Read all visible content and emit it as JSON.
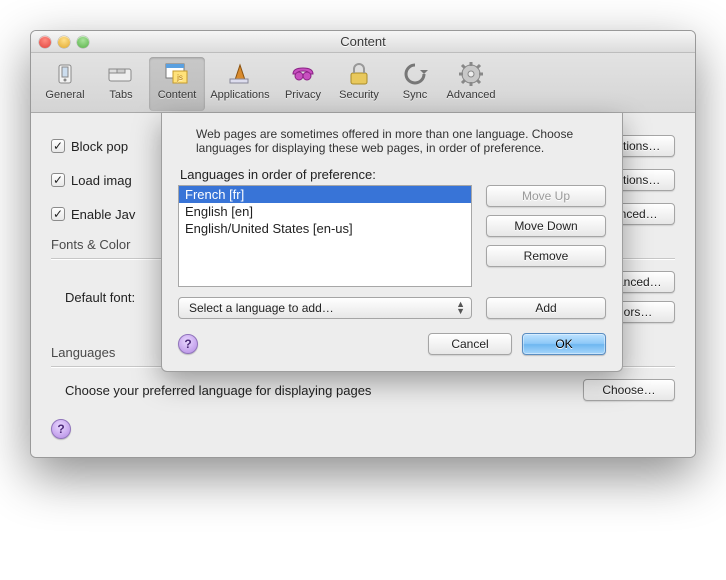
{
  "window": {
    "title": "Content"
  },
  "toolbar": {
    "items": [
      {
        "label": "General",
        "icon": "switch-icon",
        "selected": false
      },
      {
        "label": "Tabs",
        "icon": "tabs-icon",
        "selected": false
      },
      {
        "label": "Content",
        "icon": "content-icon",
        "selected": true
      },
      {
        "label": "Applications",
        "icon": "apps-icon",
        "selected": false
      },
      {
        "label": "Privacy",
        "icon": "privacy-icon",
        "selected": false
      },
      {
        "label": "Security",
        "icon": "security-icon",
        "selected": false
      },
      {
        "label": "Sync",
        "icon": "sync-icon",
        "selected": false
      },
      {
        "label": "Advanced",
        "icon": "advanced-icon",
        "selected": false
      }
    ]
  },
  "main": {
    "block_popups": {
      "label": "Block pop",
      "checked": true
    },
    "load_images": {
      "label": "Load imag",
      "checked": true
    },
    "enable_js": {
      "label": "Enable Jav",
      "checked": true
    },
    "exceptions_btn": "xceptions…",
    "exceptions_btn2": "xceptions…",
    "advanced_btn": "dvanced…",
    "fonts_header": "Fonts & Color",
    "default_font_label": "Default font:",
    "advanced_btn2": "Advanced…",
    "colors_btn": "Colors…",
    "languages_header": "Languages",
    "languages_prompt": "Choose your preferred language for displaying pages",
    "choose_btn": "Choose…"
  },
  "sheet": {
    "desc": "Web pages are sometimes offered in more than one language. Choose languages for displaying these web pages, in order of preference.",
    "list_label": "Languages in order of preference:",
    "items": [
      {
        "label": "French  [fr]",
        "selected": true
      },
      {
        "label": "English  [en]",
        "selected": false
      },
      {
        "label": "English/United States  [en-us]",
        "selected": false
      }
    ],
    "move_up": "Move Up",
    "move_down": "Move Down",
    "remove": "Remove",
    "select_placeholder": "Select a language to add…",
    "add": "Add",
    "cancel": "Cancel",
    "ok": "OK"
  }
}
